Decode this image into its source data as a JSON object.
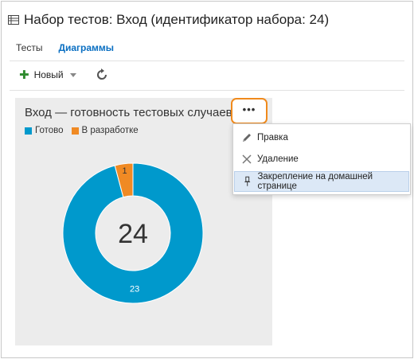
{
  "page": {
    "title": "Набор тестов: Вход (идентификатор набора: 24)"
  },
  "tabs": [
    {
      "label": "Тесты",
      "active": false
    },
    {
      "label": "Диаграммы",
      "active": true
    }
  ],
  "toolbar": {
    "new_label": "Новый",
    "icons": [
      "plus-icon",
      "chevron-down-icon",
      "refresh-icon"
    ]
  },
  "tile": {
    "title": "Вход — готовность тестовых случаев",
    "more_button_label": "•••"
  },
  "context_menu": {
    "items": [
      {
        "label": "Правка",
        "icon": "pencil-icon"
      },
      {
        "label": "Удаление",
        "icon": "close-icon"
      },
      {
        "label": "Закрепление на домашней странице",
        "icon": "pin-icon",
        "highlighted": true
      }
    ]
  },
  "colors": {
    "ready": "#0099cc",
    "in_progress": "#f08a24",
    "tile_bg": "#ececec",
    "accent": "#0a6fc2",
    "highlight_border": "#f08a1c"
  },
  "chart_data": {
    "type": "pie",
    "variant": "donut",
    "categories": [
      "Готово",
      "В разработке"
    ],
    "values": [
      23,
      1
    ],
    "total_label": "24",
    "data_labels": [
      "23",
      "1"
    ],
    "legend": [
      "Готово",
      "В разработке"
    ],
    "legend_placement": "top-left",
    "colors": [
      "#0099cc",
      "#f08a24"
    ]
  }
}
